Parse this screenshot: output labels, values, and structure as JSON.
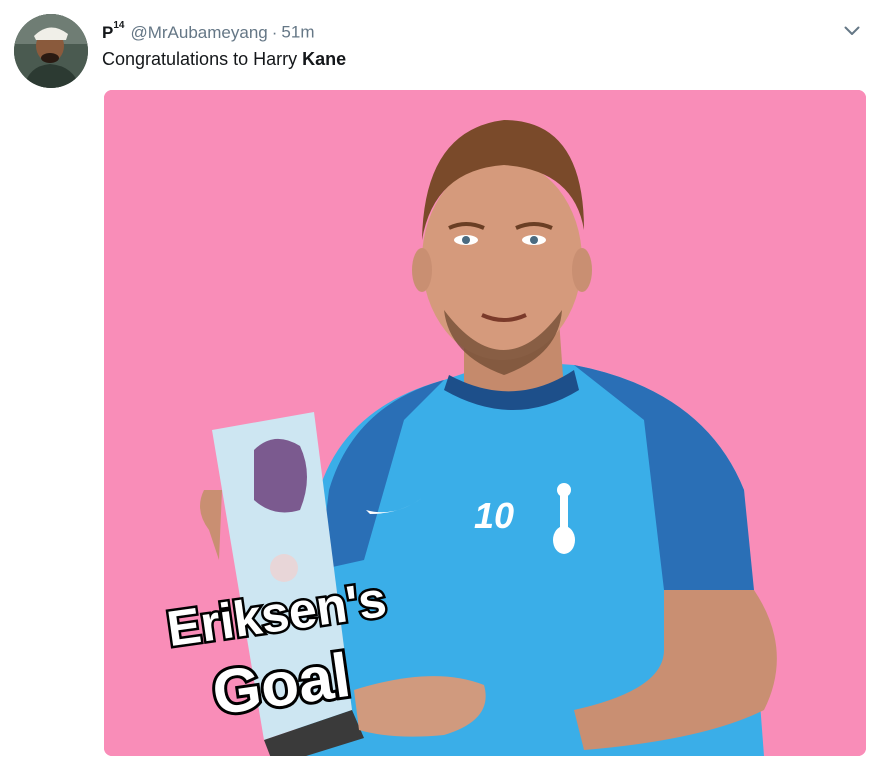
{
  "tweet": {
    "display_name": "P",
    "display_name_sup": "14",
    "handle": "@MrAubameyang",
    "separator": "·",
    "time": "51m",
    "text_prefix": "Congratulations to Harry ",
    "text_bold": "Kane"
  },
  "media": {
    "caption_line1": "Eriksen's",
    "caption_line2": "Goal",
    "shirt_number": "10",
    "background_color": "#f98db8",
    "shirt_color": "#3aaee8"
  },
  "icons": {
    "caret": "chevron-down-icon",
    "avatar": "avatar"
  }
}
